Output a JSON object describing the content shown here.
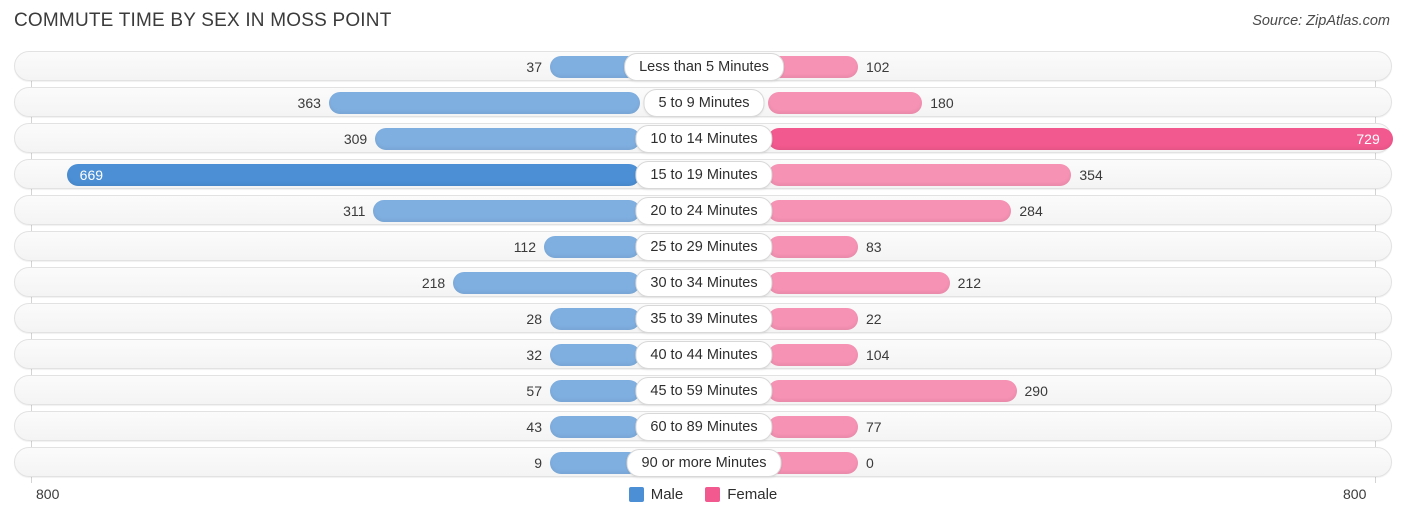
{
  "header": {
    "title": "COMMUTE TIME BY SEX IN MOSS POINT",
    "source": "Source: ZipAtlas.com"
  },
  "axis": {
    "left_max_label": "800",
    "right_max_label": "800",
    "max_value": 800
  },
  "legend": {
    "items": [
      {
        "label": "Male",
        "color": "#4c8fd4"
      },
      {
        "label": "Female",
        "color": "#f2598e"
      }
    ]
  },
  "colors": {
    "male": "#7fafe0",
    "male_max": "#4c8fd4",
    "female": "#f692b4",
    "female_max": "#f2598e",
    "track": "#f6f6f6",
    "track_border": "#e2e2e2",
    "axis_line": "#d4d4d4"
  },
  "chart_data": {
    "type": "bar",
    "orientation": "horizontal-diverging",
    "title": "COMMUTE TIME BY SEX IN MOSS POINT",
    "xlabel": "",
    "ylabel": "",
    "xlim": [
      -800,
      800
    ],
    "grid": false,
    "legend_position": "bottom-center",
    "categories": [
      "Less than 5 Minutes",
      "5 to 9 Minutes",
      "10 to 14 Minutes",
      "15 to 19 Minutes",
      "20 to 24 Minutes",
      "25 to 29 Minutes",
      "30 to 34 Minutes",
      "35 to 39 Minutes",
      "40 to 44 Minutes",
      "45 to 59 Minutes",
      "60 to 89 Minutes",
      "90 or more Minutes"
    ],
    "series": [
      {
        "name": "Male",
        "side": "left",
        "values": [
          37,
          363,
          309,
          669,
          311,
          112,
          218,
          28,
          32,
          57,
          43,
          9
        ]
      },
      {
        "name": "Female",
        "side": "right",
        "values": [
          102,
          180,
          729,
          354,
          284,
          83,
          212,
          22,
          104,
          290,
          77,
          0
        ]
      }
    ]
  }
}
